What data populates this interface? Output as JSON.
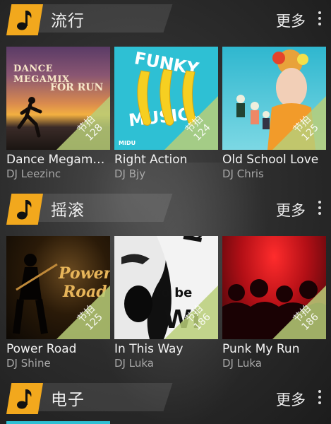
{
  "sections": [
    {
      "title": "流行",
      "more": "更多",
      "cards": [
        {
          "title": "Dance Megam…",
          "artist": "DJ Leezinc",
          "bpm_label": "节拍",
          "bpm": "128",
          "art_text": [
            "DANCE MEGAMIX",
            "FOR RUN"
          ]
        },
        {
          "title": "Right Action",
          "artist": "DJ Bjy",
          "bpm_label": "节拍",
          "bpm": "124",
          "art_text": [
            "FUNKY",
            "MUSIC",
            "MIDU"
          ]
        },
        {
          "title": "Old School Love",
          "artist": "DJ Chris",
          "bpm_label": "节拍",
          "bpm": "125",
          "art_text": []
        }
      ]
    },
    {
      "title": "摇滚",
      "more": "更多",
      "cards": [
        {
          "title": "Power Road",
          "artist": "DJ Shine",
          "bpm_label": "节拍",
          "bpm": "125",
          "art_text": [
            "Power",
            "Road"
          ]
        },
        {
          "title": "In This Way",
          "artist": "DJ Luka",
          "bpm_label": "节拍",
          "bpm": "186",
          "art_text": [
            "bo",
            "to be",
            "Wi"
          ]
        },
        {
          "title": "Punk My Run",
          "artist": "DJ Luka",
          "bpm_label": "节拍",
          "bpm": "186",
          "art_text": []
        }
      ]
    },
    {
      "title": "电子",
      "more": "更多",
      "cards": []
    }
  ],
  "colors": {
    "accent": "#f2a81d",
    "bpm_corner": "#b8ce78"
  },
  "icons": {
    "section": "music-note-icon",
    "menu": "more-vertical-icon"
  }
}
